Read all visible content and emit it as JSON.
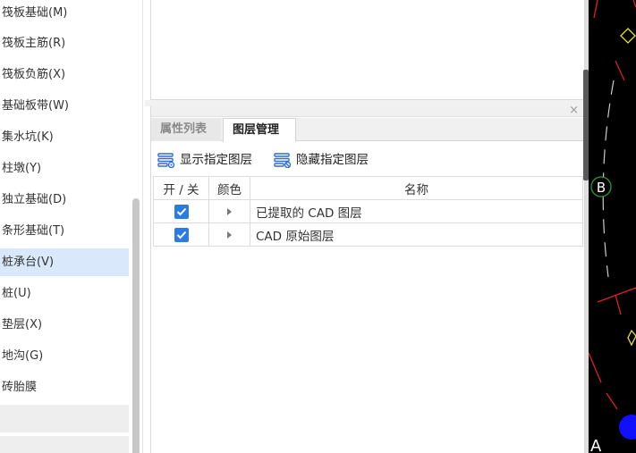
{
  "sidebar": {
    "items": [
      {
        "label": "筏板基础(M)"
      },
      {
        "label": "筏板主筋(R)"
      },
      {
        "label": "筏板负筋(X)"
      },
      {
        "label": "基础板带(W)"
      },
      {
        "label": "集水坑(K)"
      },
      {
        "label": "柱墩(Y)"
      },
      {
        "label": "独立基础(D)"
      },
      {
        "label": "条形基础(T)"
      },
      {
        "label": "桩承台(V)",
        "selected": true
      },
      {
        "label": "桩(U)"
      },
      {
        "label": "垫层(X)"
      },
      {
        "label": "地沟(G)"
      },
      {
        "label": "砖胎膜"
      }
    ]
  },
  "panel": {
    "close_label": "×",
    "tabs": [
      {
        "label": "属性列表",
        "active": false
      },
      {
        "label": "图层管理",
        "active": true
      }
    ],
    "toolbar": {
      "show_label": "显示指定图层",
      "hide_label": "隐藏指定图层"
    },
    "table": {
      "columns": [
        "开 / 关",
        "颜色",
        "名称"
      ],
      "rows": [
        {
          "checked": true,
          "name": "已提取的 CAD 图层"
        },
        {
          "checked": true,
          "name": "CAD 原始图层"
        }
      ]
    }
  },
  "canvas": {
    "labels": {
      "b": "B",
      "a": "A"
    },
    "colors": {
      "background": "#000000",
      "line_red": "#e02020",
      "line_white": "#cccccc",
      "marker_blue": "#1010ff",
      "marker_yellow": "#e8e030",
      "circle_green": "#1f9e3a"
    }
  }
}
